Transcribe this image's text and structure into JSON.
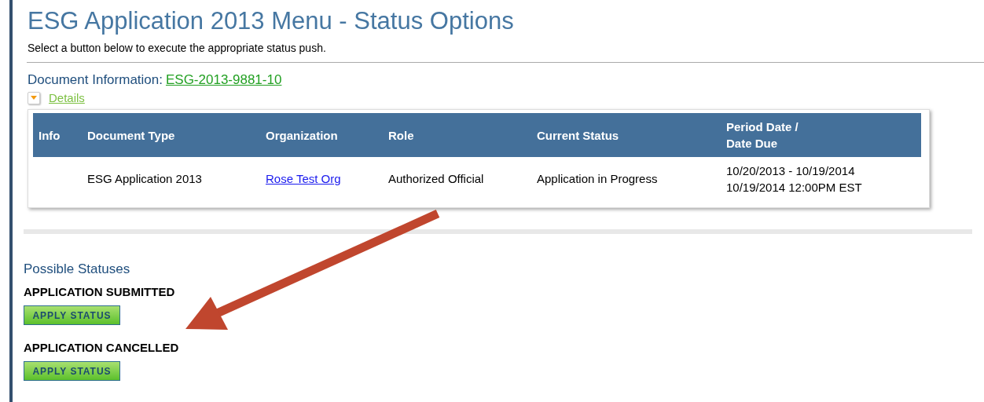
{
  "page": {
    "title": "ESG Application 2013 Menu - Status Options",
    "instructions": "Select a button below to execute the appropriate status push."
  },
  "document_info": {
    "label": "Document Information:",
    "link": "ESG-2013-9881-10"
  },
  "details": {
    "label": "Details",
    "expanded": false
  },
  "table": {
    "columns": [
      "Info",
      "Document Type",
      "Organization",
      "Role",
      "Current Status",
      "Period Date /\nDate Due"
    ],
    "rows": [
      {
        "info": "",
        "document_type": "ESG Application 2013",
        "organization": "Rose Test Org",
        "role": "Authorized Official",
        "current_status": "Application in Progress",
        "period_lines": [
          "10/20/2013 - 10/19/2014",
          "10/19/2014 12:00PM EST"
        ]
      }
    ]
  },
  "possible_statuses": {
    "heading": "Possible Statuses",
    "items": [
      {
        "name": "APPLICATION SUBMITTED",
        "button": "APPLY STATUS"
      },
      {
        "name": "APPLICATION CANCELLED",
        "button": "APPLY STATUS"
      }
    ]
  }
}
